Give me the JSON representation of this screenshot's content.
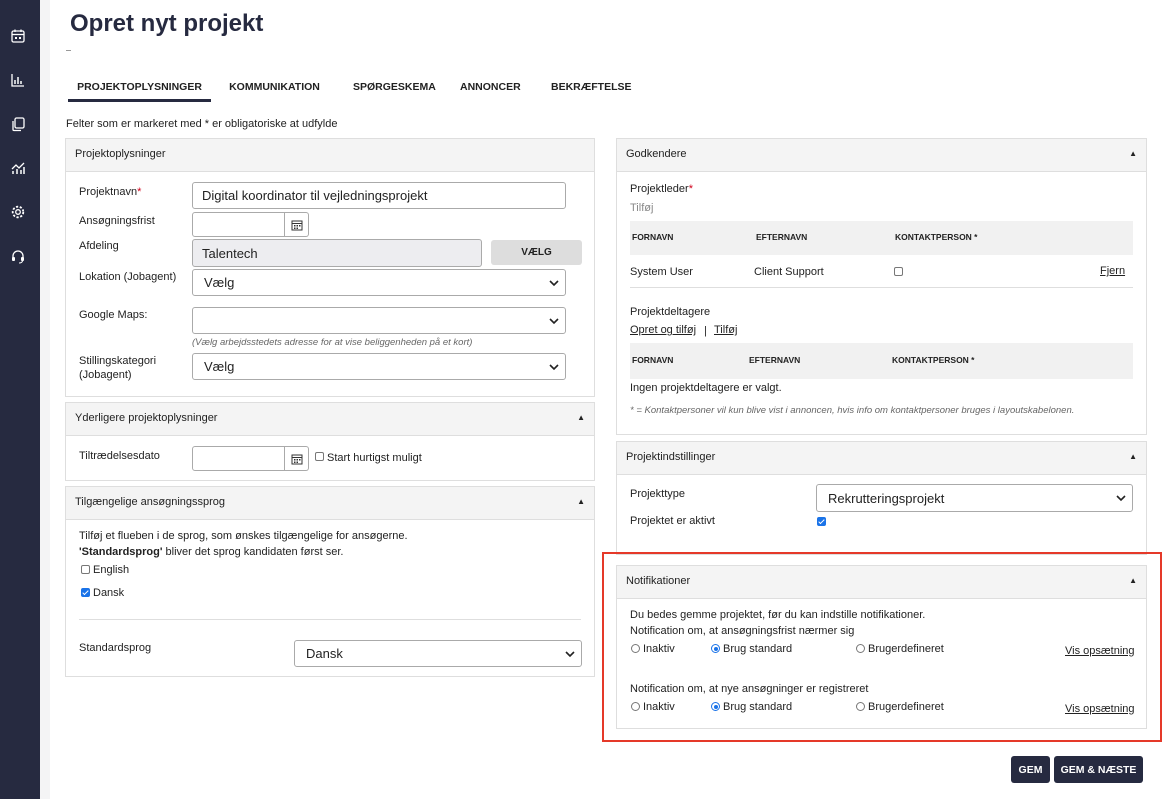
{
  "page": {
    "title": "Opret nyt projekt"
  },
  "tabs": [
    {
      "label": "PROJEKTOPLYSNINGER",
      "active": true
    },
    {
      "label": "KOMMUNIKATION"
    },
    {
      "label": "SPØRGESKEMA"
    },
    {
      "label": "ANNONCER"
    },
    {
      "label": "BEKRÆFTELSE"
    }
  ],
  "required_note": "Felter som er markeret med * er obligatoriske at udfylde",
  "projektoplysninger": {
    "title": "Projektoplysninger",
    "projektnavn_label": "Projektnavn",
    "projektnavn_value": "Digital koordinator til vejledningsprojekt",
    "frist_label": "Ansøgningsfrist",
    "frist_value": "",
    "afdeling_label": "Afdeling",
    "afdeling_value": "Talentech",
    "vaelg_button": "VÆLG",
    "lokation_label": "Lokation (Jobagent)",
    "lokation_value": "Vælg",
    "maps_label": "Google Maps:",
    "maps_value": "",
    "maps_hint": "(Vælg arbejdsstedets adresse for at vise beliggenheden på et kort)",
    "kategori_label_1": "Stillingskategori",
    "kategori_label_2": "(Jobagent)",
    "kategori_value": "Vælg"
  },
  "yderligere": {
    "title": "Yderligere projektoplysninger",
    "tiltraedelse_label": "Tiltrædelsesdato",
    "tiltraedelse_value": "",
    "hurtigst_label": "Start hurtigst muligt",
    "hurtigst_checked": false
  },
  "sprog": {
    "title": "Tilgængelige ansøgningssprog",
    "desc": "Tilføj et flueben i de sprog, som ønskes tilgængelige for ansøgerne.",
    "desc2_bold": "'Standardsprog'",
    "desc2_rest": " bliver det sprog kandidaten først ser.",
    "languages": [
      {
        "label": "English",
        "checked": false
      },
      {
        "label": "Dansk",
        "checked": true
      }
    ],
    "standard_label": "Standardsprog",
    "standard_value": "Dansk"
  },
  "godkendere": {
    "title": "Godkendere",
    "projektleder_label": "Projektleder",
    "tilfoj_label": "Tilføj",
    "columns": [
      "FORNAVN",
      "EFTERNAVN",
      "KONTAKTPERSON *"
    ],
    "row": {
      "fornavn": "System User",
      "efternavn": "Client Support",
      "kontakt": false,
      "remove": "Fjern"
    },
    "deltagere_label": "Projektdeltagere",
    "opret_link": "Opret og tilføj",
    "link_sep": "|",
    "tilfoj_link": "Tilføj",
    "empty": "Ingen projektdeltagere er valgt.",
    "footnote": "* = Kontaktpersoner vil kun blive vist i annoncen, hvis info om kontaktpersoner bruges i layoutskabelonen."
  },
  "indstillinger": {
    "title": "Projektindstillinger",
    "type_label": "Projekttype",
    "type_value": "Rekrutteringsprojekt",
    "aktiv_label": "Projektet er aktivt",
    "aktiv_checked": true
  },
  "notifikationer": {
    "title": "Notifikationer",
    "intro": "Du bedes gemme projektet, før du kan indstille notifikationer.",
    "groups": [
      {
        "label": "Notification om, at ansøgningsfrist nærmer sig",
        "options": [
          "Inaktiv",
          "Brug standard",
          "Brugerdefineret"
        ],
        "selected": 1,
        "link": "Vis opsætning"
      },
      {
        "label": "Notification om, at nye ansøgninger er registreret",
        "options": [
          "Inaktiv",
          "Brug standard",
          "Brugerdefineret"
        ],
        "selected": 1,
        "link": "Vis opsætning"
      }
    ]
  },
  "actions": {
    "save": "GEM",
    "save_next": "GEM & NÆSTE"
  },
  "icons": [
    "calendar-icon",
    "bar-chart-icon",
    "copy-icon",
    "analytics-icon",
    "gear-icon",
    "headset-icon",
    "chevron-down-icon",
    "collapse-arrow-icon"
  ],
  "colors": {
    "sidebar": "#262a40",
    "accent": "#1a73e8",
    "highlight": "#e53929",
    "required": "#d0021b"
  }
}
